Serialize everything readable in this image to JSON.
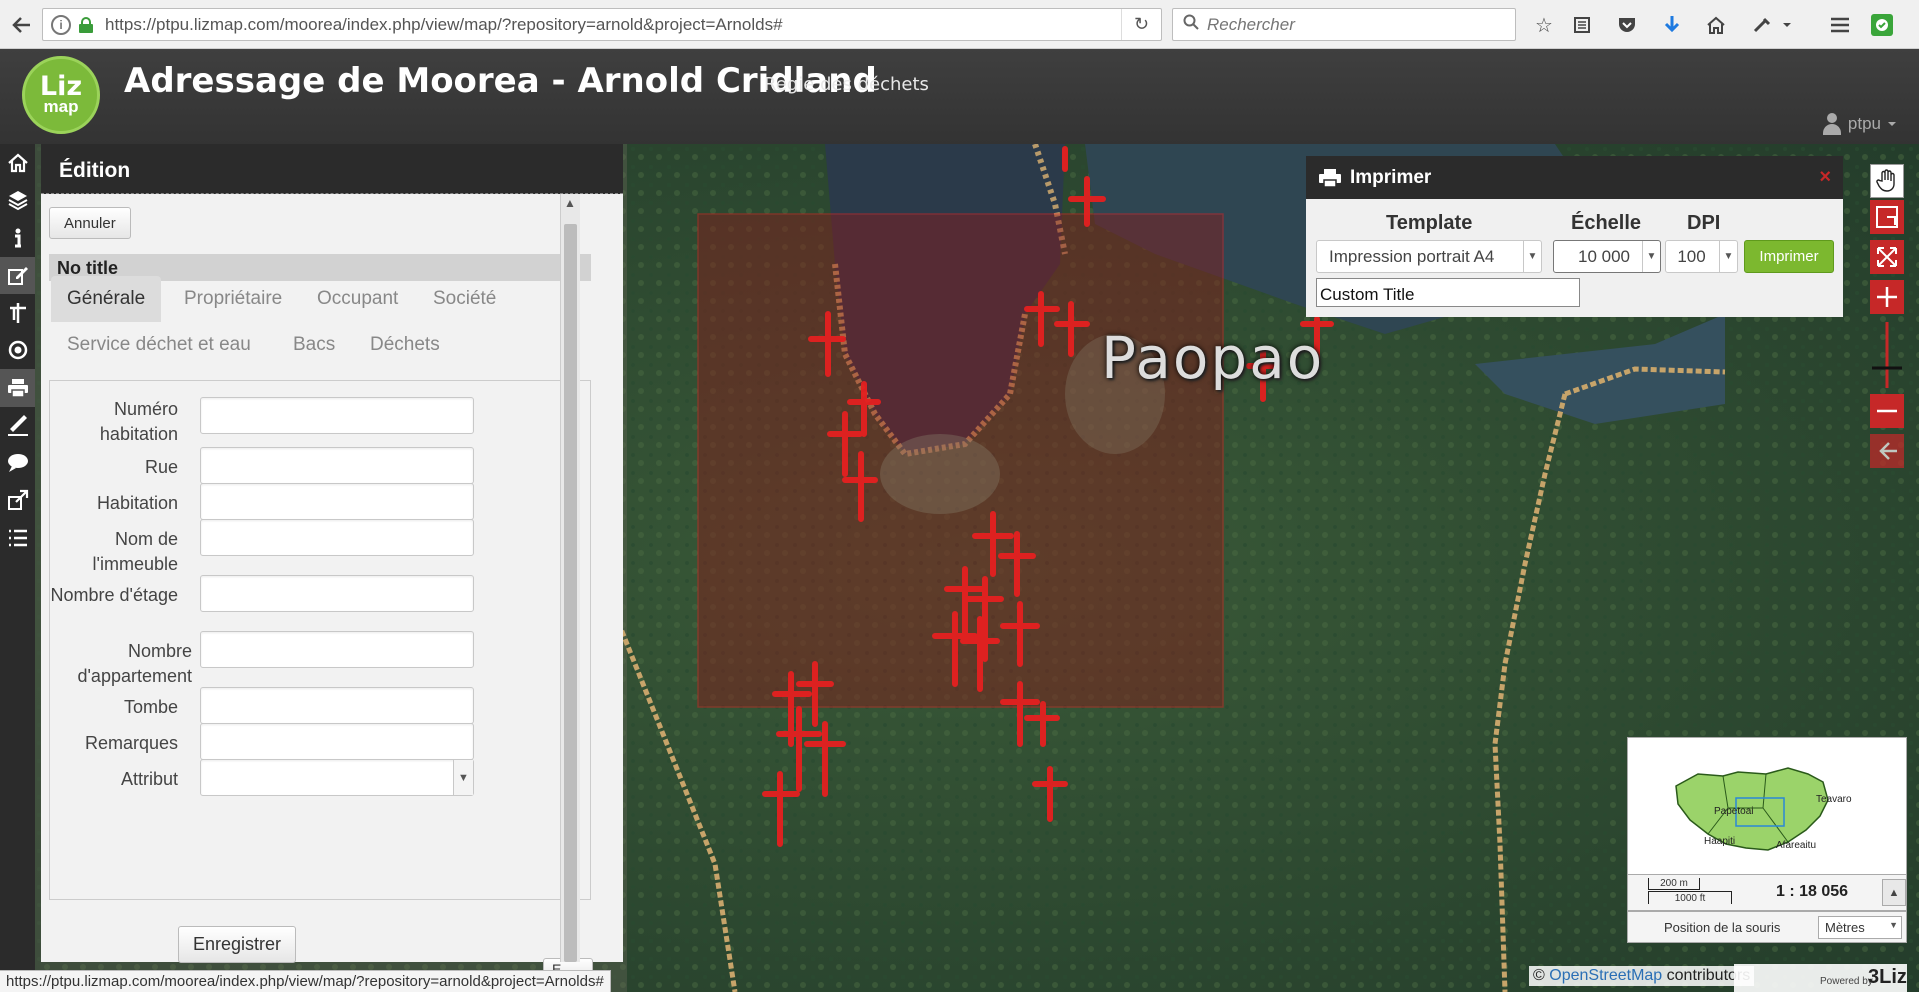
{
  "browser": {
    "url": "https://ptpu.lizmap.com/moorea/index.php/view/map/?repository=arnold&project=Arnolds#",
    "search_placeholder": "Rechercher"
  },
  "header": {
    "logo_line1": "Liz",
    "logo_line2": "map",
    "title": "Adressage de Moorea - Arnold Cridland",
    "subtitle": "Regie des déchets",
    "user": "ptpu"
  },
  "menu": {
    "items": [
      "home-icon",
      "layers-icon",
      "info-icon",
      "edition-icon",
      "locate-icon",
      "geolocation-icon",
      "print-icon",
      "measure-icon",
      "tooltip-icon",
      "permalink-icon",
      "legend-icon"
    ]
  },
  "edition": {
    "title": "Édition",
    "cancel_label": "Annuler",
    "form_title": "No title",
    "tabs": [
      {
        "label": "Générale",
        "active": true
      },
      {
        "label": "Propriétaire",
        "active": false
      },
      {
        "label": "Occupant",
        "active": false
      },
      {
        "label": "Société",
        "active": false
      },
      {
        "label": "Service déchet et eau",
        "active": false
      },
      {
        "label": "Bacs",
        "active": false
      },
      {
        "label": "Déchets",
        "active": false
      }
    ],
    "fields": [
      {
        "label": "Numéro habitation",
        "value": ""
      },
      {
        "label": "Rue",
        "value": ""
      },
      {
        "label": "Habitation",
        "value": ""
      },
      {
        "label": "Nom de l'immeuble",
        "value": ""
      },
      {
        "label": "Nombre d'étage",
        "value": ""
      },
      {
        "label": "Nombre d'appartement",
        "value": ""
      },
      {
        "label": "Tombe",
        "value": ""
      },
      {
        "label": "Remarques",
        "value": ""
      },
      {
        "label": "Attribut",
        "value": ""
      }
    ],
    "save_label": "Enregistrer",
    "partial_button": "E"
  },
  "print": {
    "title": "Imprimer",
    "close": "×",
    "template_header": "Template",
    "scale_header": "Échelle",
    "dpi_header": "DPI",
    "template_value": "Impression portrait A4",
    "scale_value": "10 000",
    "dpi_value": "100",
    "print_label": "Imprimer",
    "custom_title_value": "Custom Title"
  },
  "map": {
    "place_label": "Paopao",
    "overview_labels": [
      "Papetoai",
      "Teavaro",
      "Haapiti",
      "Afareaitu"
    ],
    "scale_metric": "200 m",
    "scale_imperial": "1000 ft",
    "scale_ratio": "1 : 18 056",
    "mouse_position_label": "Position de la souris",
    "mouse_units": "Mètres",
    "attribution_prefix": "©",
    "attribution_link": "OpenStreetMap",
    "attribution_suffix": "contributors",
    "powered_by": "Powered by",
    "powered_brand": "3Liz"
  },
  "status": {
    "url": "https://ptpu.lizmap.com/moorea/index.php/view/map/?repository=arnold&project=Arnolds#"
  },
  "colors": {
    "accent_red": "#c62828",
    "accent_green": "#7cb82f",
    "print_area": "#8a1a1a",
    "marker_red": "#e52020"
  }
}
